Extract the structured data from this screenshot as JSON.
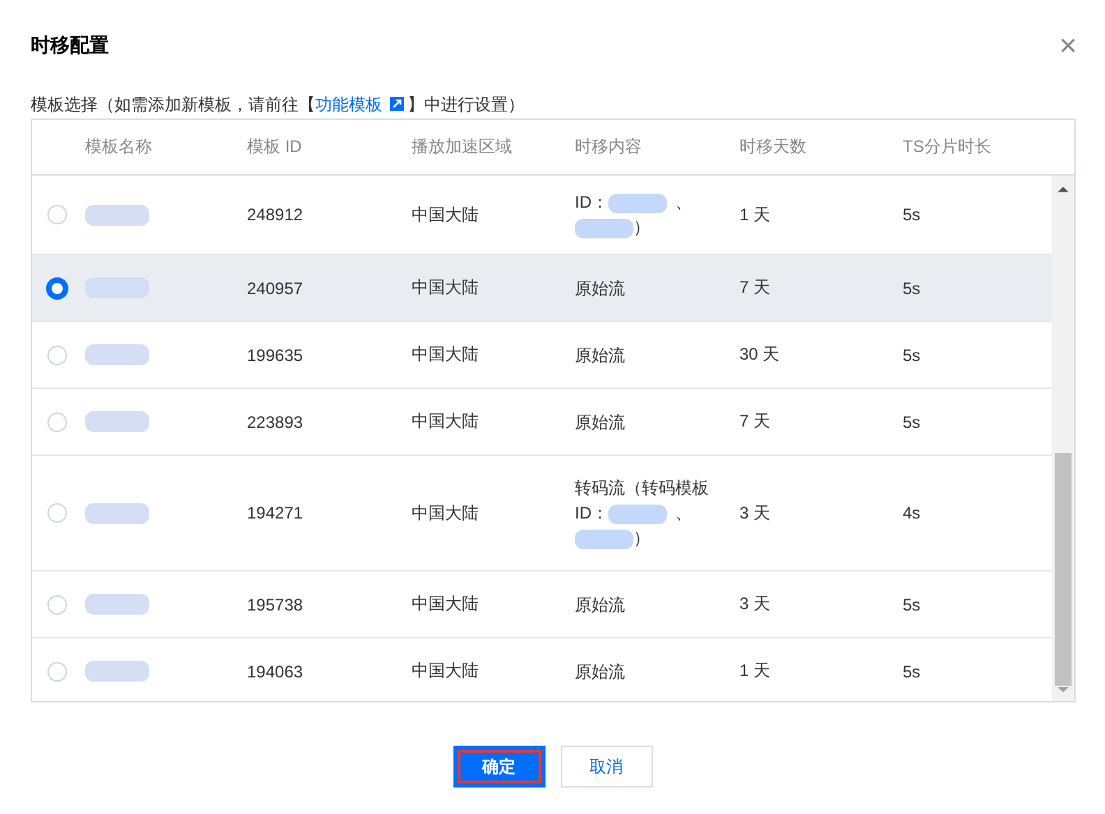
{
  "dialog": {
    "title": "时移配置",
    "close": "×"
  },
  "hint": {
    "before": "模板选择（如需添加新模板，请前往【",
    "link": "功能模板",
    "after": "】中进行设置）"
  },
  "table": {
    "columns": [
      "模板名称",
      "模板 ID",
      "播放加速区域",
      "时移内容",
      "时移天数",
      "TS分片时长"
    ],
    "rows": [
      {
        "selected": false,
        "id": "248912",
        "region": "中国大陆",
        "content": {
          "kind": "transcode",
          "id_label": "ID：",
          "separator": "、",
          "close": "）"
        },
        "days": "1 天",
        "ts": "5s"
      },
      {
        "selected": true,
        "id": "240957",
        "region": "中国大陆",
        "content": {
          "kind": "original",
          "text": "原始流"
        },
        "days": "7 天",
        "ts": "5s"
      },
      {
        "selected": false,
        "id": "199635",
        "region": "中国大陆",
        "content": {
          "kind": "original",
          "text": "原始流"
        },
        "days": "30 天",
        "ts": "5s"
      },
      {
        "selected": false,
        "id": "223893",
        "region": "中国大陆",
        "content": {
          "kind": "original",
          "text": "原始流"
        },
        "days": "7 天",
        "ts": "5s"
      },
      {
        "selected": false,
        "id": "194271",
        "region": "中国大陆",
        "content": {
          "kind": "transcode",
          "head": "转码流（转码模板",
          "id_label": "ID：",
          "separator": "、",
          "close": "）"
        },
        "days": "3 天",
        "ts": "4s"
      },
      {
        "selected": false,
        "id": "195738",
        "region": "中国大陆",
        "content": {
          "kind": "original",
          "text": "原始流"
        },
        "days": "3 天",
        "ts": "5s"
      },
      {
        "selected": false,
        "id": "194063",
        "region": "中国大陆",
        "content": {
          "kind": "original",
          "text": "原始流"
        },
        "days": "1 天",
        "ts": "5s"
      }
    ]
  },
  "buttons": [
    {
      "label": "确定",
      "kind": "primary",
      "highlighted": true
    },
    {
      "label": "取消",
      "kind": "secondary",
      "highlighted": false
    }
  ]
}
